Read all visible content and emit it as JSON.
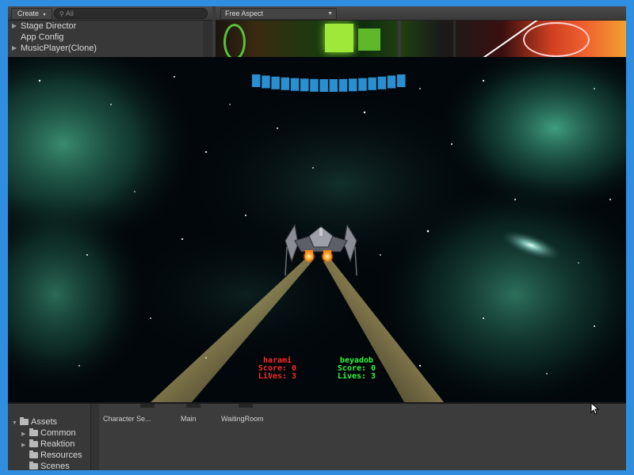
{
  "hierarchy": {
    "create_label": "Create",
    "search_placeholder": "All",
    "items": [
      {
        "label": "Stage Director",
        "has_children": true
      },
      {
        "label": "App Config",
        "has_children": false
      },
      {
        "label": "MusicPlayer(Clone)",
        "has_children": true
      }
    ]
  },
  "game_view": {
    "aspect_label": "Free Aspect"
  },
  "hud": {
    "health_segments": 16,
    "health_color": "#2a8fd0",
    "players": [
      {
        "name": "harami",
        "score": "Score: 0",
        "lives": "Lives: 3",
        "color": "#ff2a2a"
      },
      {
        "name": "beyadob",
        "score": "Score: 0",
        "lives": "Lives: 3",
        "color": "#2aff3a"
      }
    ]
  },
  "project": {
    "root": "Assets",
    "folders": [
      {
        "label": "Common",
        "has_children": true
      },
      {
        "label": "Reaktion",
        "has_children": true
      },
      {
        "label": "Resources",
        "has_children": false
      },
      {
        "label": "Scenes",
        "has_children": false
      }
    ],
    "scenes": [
      "Character Se...",
      "Main",
      "WaitingRoom"
    ]
  },
  "icons": {
    "cursor": "mouse-pointer-icon",
    "folder": "folder-icon",
    "search": "search-icon"
  }
}
